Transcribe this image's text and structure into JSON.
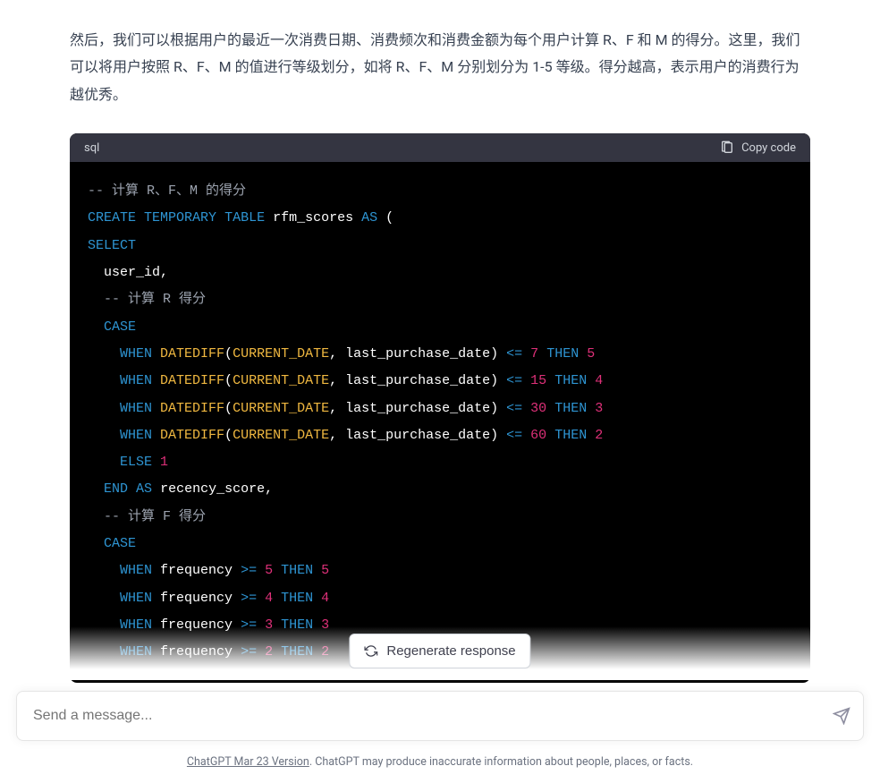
{
  "explanation": "然后，我们可以根据用户的最近一次消费日期、消费频次和消费金额为每个用户计算 R、F 和 M 的得分。这里，我们可以将用户按照 R、F、M 的值进行等级划分，如将 R、F、M 分别划分为 1-5 等级。得分越高，表示用户的消费行为越优秀。",
  "code": {
    "language": "sql",
    "copy_label": "Copy code",
    "tokens": {
      "comment1": "-- 计算 R、F、M 的得分",
      "create": "CREATE",
      "temporary": "TEMPORARY",
      "table": "TABLE",
      "tablename": " rfm_scores ",
      "as": "AS",
      "paren_open": " (",
      "select": "SELECT",
      "user_id": "  user_id,",
      "comment_r": "  -- 计算 R 得分",
      "case": "  CASE",
      "when": "WHEN",
      "datediff": " DATEDIFF",
      "paren1": "(",
      "current_date": "CURRENT_DATE",
      "comma_arg": ", last_purchase_date) ",
      "lte": "<=",
      "then": "THEN",
      "num7": "7",
      "num5": "5",
      "num15": "15",
      "num4": "4",
      "num30": "30",
      "num3": "3",
      "num60": "60",
      "num2": "2",
      "num1": "1",
      "else": "ELSE",
      "end": "END",
      "as2": "AS",
      "recency": " recency_score,",
      "comment_f": "  -- 计算 F 得分",
      "freq": " frequency ",
      "gte": ">="
    }
  },
  "regenerate_label": "Regenerate response",
  "input": {
    "placeholder": "Send a message..."
  },
  "footer": {
    "link_text": "ChatGPT Mar 23 Version",
    "rest": ". ChatGPT may produce inaccurate information about people, places, or facts."
  }
}
